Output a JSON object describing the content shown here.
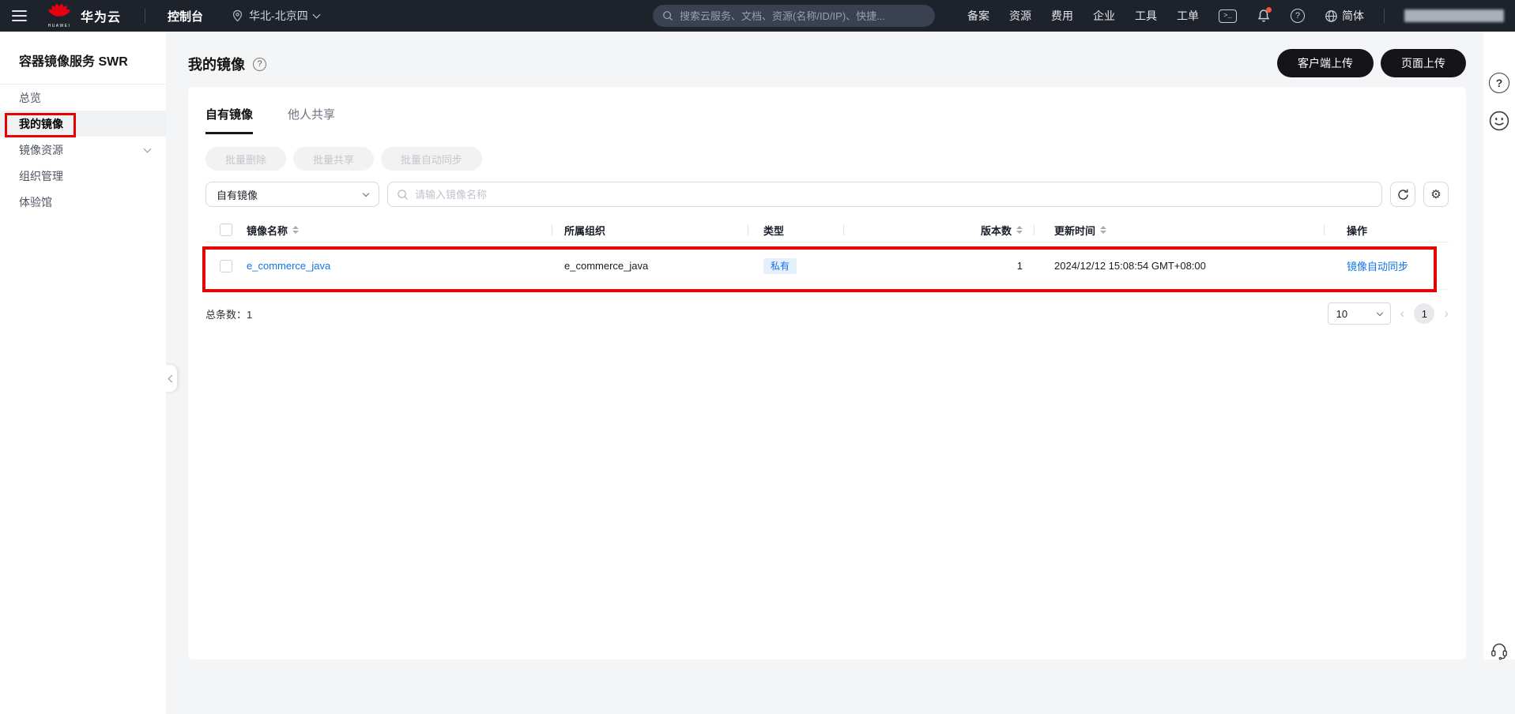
{
  "topbar": {
    "brand": "华为云",
    "logo_text": "HUAWEI",
    "console_label": "控制台",
    "region": "华北-北京四",
    "search_placeholder": "搜索云服务、文档、资源(名称/ID/IP)、快捷...",
    "menu_items": [
      "备案",
      "资源",
      "费用",
      "企业",
      "工具",
      "工单"
    ],
    "terminal_glyph": ">_",
    "language": "简体"
  },
  "sidebar": {
    "title": "容器镜像服务 SWR",
    "items": [
      {
        "label": "总览"
      },
      {
        "label": "我的镜像"
      },
      {
        "label": "镜像资源"
      },
      {
        "label": "组织管理"
      },
      {
        "label": "体验馆"
      }
    ]
  },
  "page": {
    "title": "我的镜像",
    "client_upload": "客户端上传",
    "page_upload": "页面上传"
  },
  "tabs": [
    {
      "label": "自有镜像"
    },
    {
      "label": "他人共享"
    }
  ],
  "batch_buttons": [
    "批量删除",
    "批量共享",
    "批量自动同步"
  ],
  "filter": {
    "type_selected": "自有镜像",
    "search_placeholder": "请输入镜像名称"
  },
  "table": {
    "headers": [
      "镜像名称",
      "所属组织",
      "类型",
      "版本数",
      "更新时间",
      "操作"
    ],
    "row": {
      "name": "e_commerce_java",
      "org": "e_commerce_java",
      "type": "私有",
      "versions": "1",
      "updated": "2024/12/12 15:08:54 GMT+08:00",
      "action": "镜像自动同步"
    }
  },
  "footer": {
    "total_label": "总条数：",
    "total_value": "1",
    "page_size": "10",
    "current_page": "1"
  },
  "colors": {
    "topbar_bg": "#1e222b",
    "link_blue": "#1173e8",
    "badge_bg": "#e6effc",
    "button_black": "#141419",
    "active_item_bg": "#f0f1f3",
    "annotation_red": "#e60000",
    "huawei_red": "#e60012"
  }
}
